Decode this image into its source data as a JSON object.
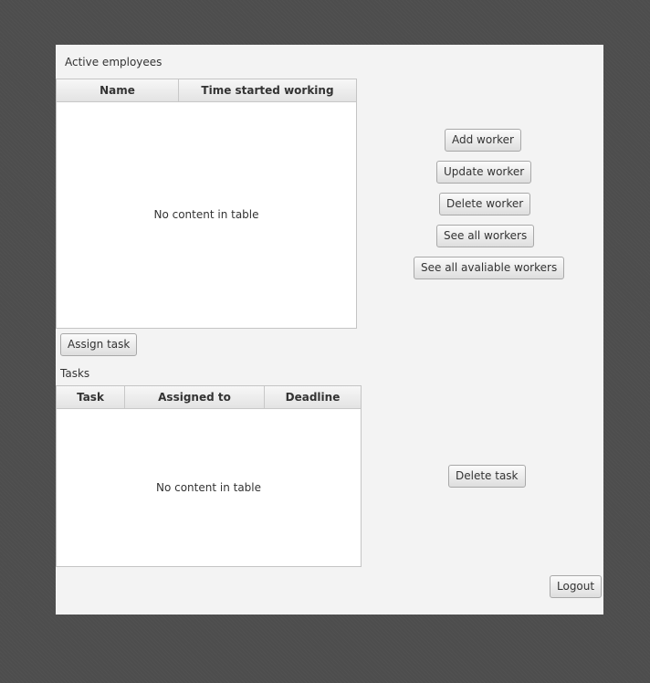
{
  "employees": {
    "label": "Active employees",
    "columns": [
      "Name",
      "Time started working"
    ],
    "placeholder": "No content in table"
  },
  "tasks": {
    "label": "Tasks",
    "columns": [
      "Task",
      "Assigned to",
      "Deadline"
    ],
    "placeholder": "No content in table"
  },
  "buttons": {
    "add_worker": "Add worker",
    "update_worker": "Update worker",
    "delete_worker": "Delete worker",
    "see_all_workers": "See all workers",
    "see_all_available_workers": "See all avaliable workers",
    "assign_task": "Assign task",
    "delete_task": "Delete task",
    "logout": "Logout"
  }
}
